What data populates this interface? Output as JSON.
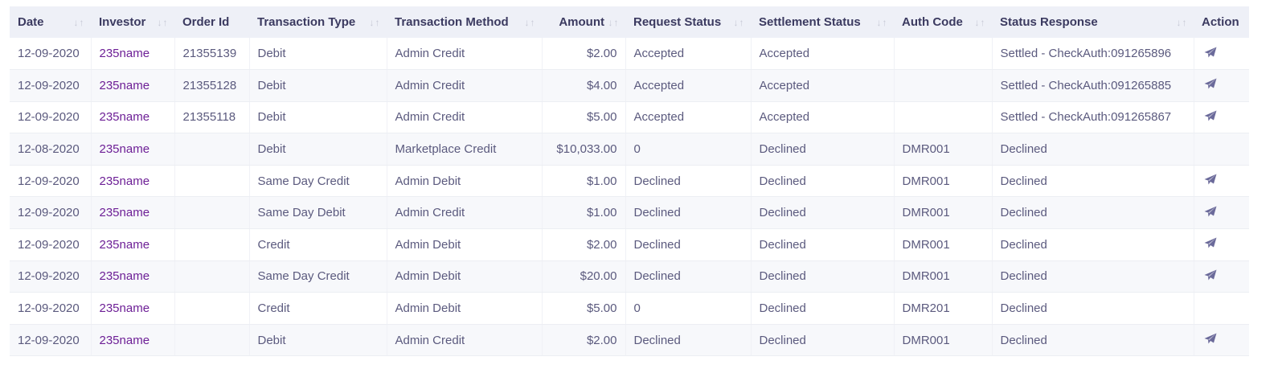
{
  "columns": [
    {
      "key": "date",
      "label": "Date",
      "sortable": true
    },
    {
      "key": "investor",
      "label": "Investor",
      "sortable": true
    },
    {
      "key": "order_id",
      "label": "Order Id",
      "sortable": false
    },
    {
      "key": "transaction_type",
      "label": "Transaction Type",
      "sortable": true
    },
    {
      "key": "transaction_method",
      "label": "Transaction Method",
      "sortable": true
    },
    {
      "key": "amount",
      "label": "Amount",
      "sortable": true
    },
    {
      "key": "request_status",
      "label": "Request Status",
      "sortable": true
    },
    {
      "key": "settlement_status",
      "label": "Settlement Status",
      "sortable": true
    },
    {
      "key": "auth_code",
      "label": "Auth Code",
      "sortable": true
    },
    {
      "key": "status_response",
      "label": "Status Response",
      "sortable": true
    },
    {
      "key": "action",
      "label": "Action",
      "sortable": false
    }
  ],
  "rows": [
    {
      "date": "12-09-2020",
      "investor": "235name",
      "order_id": "21355139",
      "transaction_type": "Debit",
      "transaction_method": "Admin Credit",
      "amount": "$2.00",
      "request_status": "Accepted",
      "settlement_status": "Accepted",
      "auth_code": "",
      "status_response": "Settled - CheckAuth:091265896",
      "action_icon": "send-icon",
      "has_action": true
    },
    {
      "date": "12-09-2020",
      "investor": "235name",
      "order_id": "21355128",
      "transaction_type": "Debit",
      "transaction_method": "Admin Credit",
      "amount": "$4.00",
      "request_status": "Accepted",
      "settlement_status": "Accepted",
      "auth_code": "",
      "status_response": "Settled - CheckAuth:091265885",
      "action_icon": "send-icon",
      "has_action": true
    },
    {
      "date": "12-09-2020",
      "investor": "235name",
      "order_id": "21355118",
      "transaction_type": "Debit",
      "transaction_method": "Admin Credit",
      "amount": "$5.00",
      "request_status": "Accepted",
      "settlement_status": "Accepted",
      "auth_code": "",
      "status_response": "Settled - CheckAuth:091265867",
      "action_icon": "send-icon",
      "has_action": true
    },
    {
      "date": "12-08-2020",
      "investor": "235name",
      "order_id": "",
      "transaction_type": "Debit",
      "transaction_method": "Marketplace Credit",
      "amount": "$10,033.00",
      "request_status": "0",
      "settlement_status": "Declined",
      "auth_code": "DMR001",
      "status_response": "Declined",
      "action_icon": "",
      "has_action": false
    },
    {
      "date": "12-09-2020",
      "investor": "235name",
      "order_id": "",
      "transaction_type": "Same Day Credit",
      "transaction_method": "Admin Debit",
      "amount": "$1.00",
      "request_status": "Declined",
      "settlement_status": "Declined",
      "auth_code": "DMR001",
      "status_response": "Declined",
      "action_icon": "send-icon",
      "has_action": true
    },
    {
      "date": "12-09-2020",
      "investor": "235name",
      "order_id": "",
      "transaction_type": "Same Day Debit",
      "transaction_method": "Admin Credit",
      "amount": "$1.00",
      "request_status": "Declined",
      "settlement_status": "Declined",
      "auth_code": "DMR001",
      "status_response": "Declined",
      "action_icon": "send-icon",
      "has_action": true
    },
    {
      "date": "12-09-2020",
      "investor": "235name",
      "order_id": "",
      "transaction_type": "Credit",
      "transaction_method": "Admin Debit",
      "amount": "$2.00",
      "request_status": "Declined",
      "settlement_status": "Declined",
      "auth_code": "DMR001",
      "status_response": "Declined",
      "action_icon": "send-icon",
      "has_action": true
    },
    {
      "date": "12-09-2020",
      "investor": "235name",
      "order_id": "",
      "transaction_type": "Same Day Credit",
      "transaction_method": "Admin Debit",
      "amount": "$20.00",
      "request_status": "Declined",
      "settlement_status": "Declined",
      "auth_code": "DMR001",
      "status_response": "Declined",
      "action_icon": "send-icon",
      "has_action": true
    },
    {
      "date": "12-09-2020",
      "investor": "235name",
      "order_id": "",
      "transaction_type": "Credit",
      "transaction_method": "Admin Debit",
      "amount": "$5.00",
      "request_status": "0",
      "settlement_status": "Declined",
      "auth_code": "DMR201",
      "status_response": "Declined",
      "action_icon": "",
      "has_action": false
    },
    {
      "date": "12-09-2020",
      "investor": "235name",
      "order_id": "",
      "transaction_type": "Debit",
      "transaction_method": "Admin Credit",
      "amount": "$2.00",
      "request_status": "Declined",
      "settlement_status": "Declined",
      "auth_code": "DMR001",
      "status_response": "Declined",
      "action_icon": "send-icon",
      "has_action": true
    }
  ],
  "colors": {
    "header_bg": "#eef0f7",
    "investor_link": "#6d1f96",
    "text": "#5b5a7e",
    "icon": "#6b6a9a"
  }
}
